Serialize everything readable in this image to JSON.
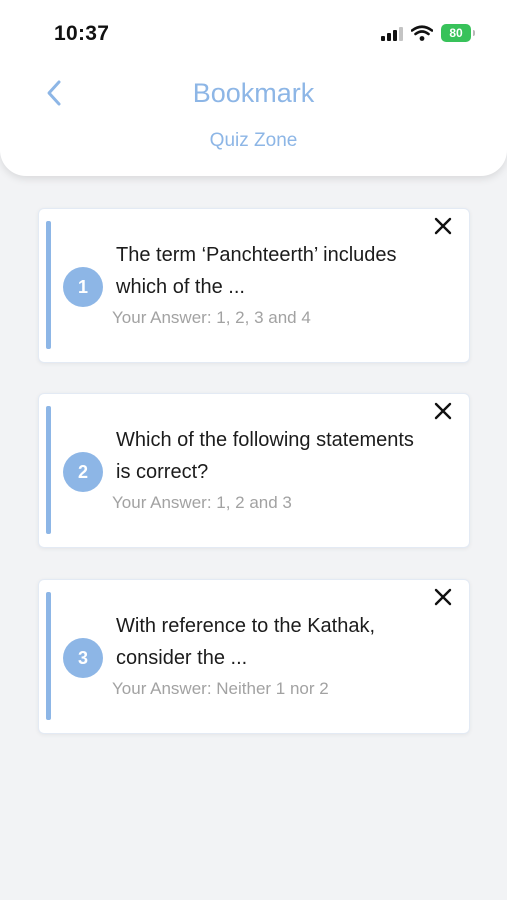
{
  "status_bar": {
    "time": "10:37",
    "battery": "80",
    "icons": [
      "signal-icon",
      "wifi-icon",
      "battery-icon"
    ]
  },
  "header": {
    "title": "Bookmark",
    "subtitle": "Quiz Zone",
    "back_icon": "chevron-left-icon"
  },
  "bookmarks": [
    {
      "number": "1",
      "question": "The term ‘Panchteerth’ includes which of the ...",
      "answer": "Your Answer: 1, 2, 3 and 4"
    },
    {
      "number": "2",
      "question": "Which of the following statements is correct?",
      "answer": "Your Answer: 1, 2 and 3"
    },
    {
      "number": "3",
      "question": "With reference to the Kathak, consider the ...",
      "answer": "Your Answer: Neither 1 nor 2"
    }
  ],
  "colors": {
    "accent": "#8db6e6",
    "background": "#f2f3f5",
    "battery": "#38c25a",
    "answer_text": "#a2a2a2"
  }
}
